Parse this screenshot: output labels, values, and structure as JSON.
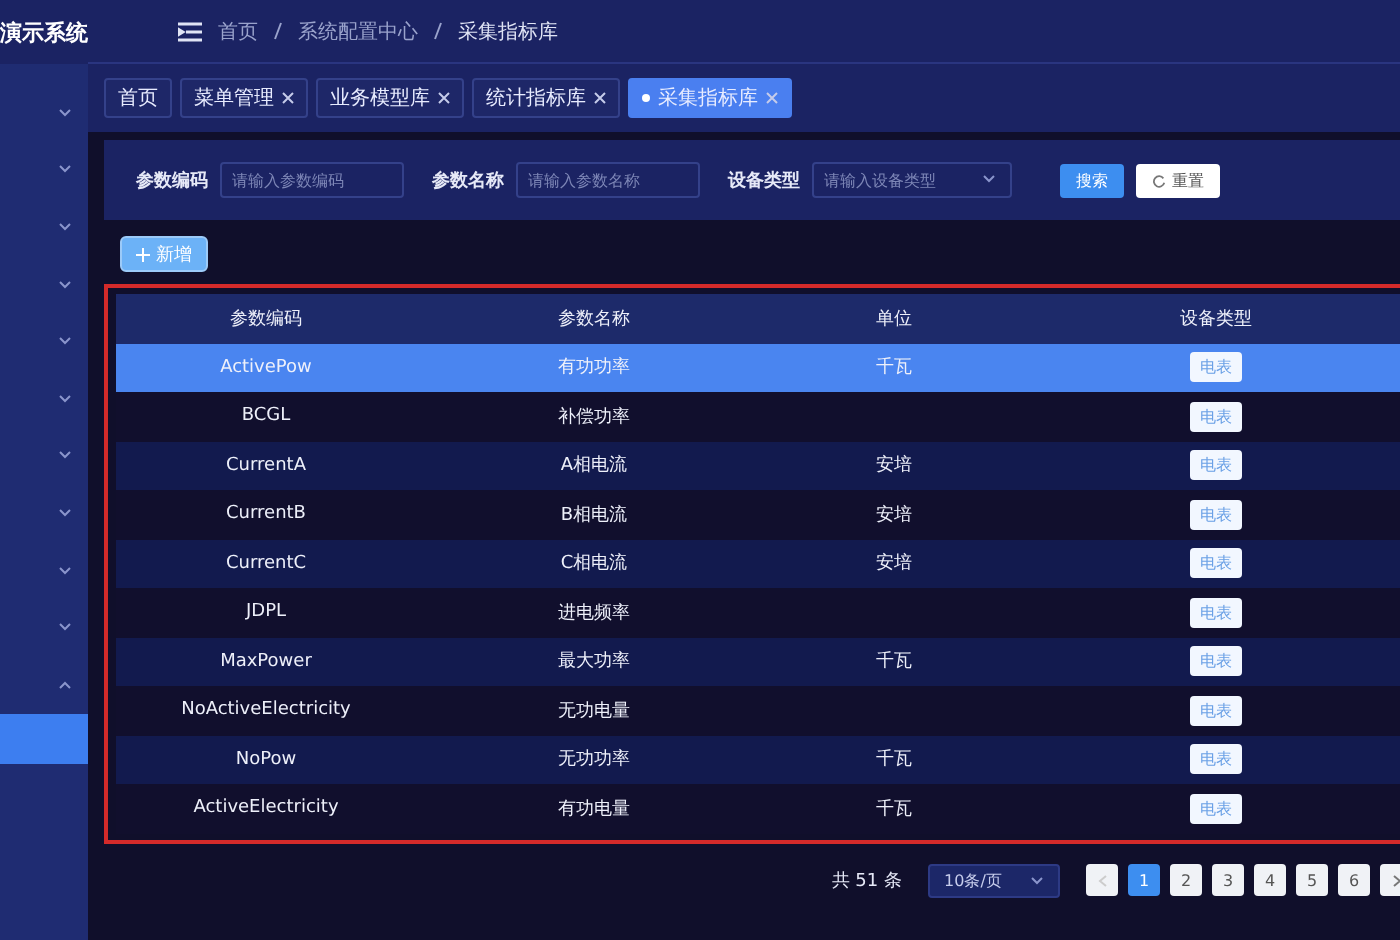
{
  "app_title": "演示系统",
  "sidebar": {
    "items": [
      {
        "expanded": false
      },
      {
        "expanded": false
      },
      {
        "expanded": false
      },
      {
        "expanded": false
      },
      {
        "expanded": false
      },
      {
        "expanded": false
      },
      {
        "expanded": false
      },
      {
        "expanded": false
      },
      {
        "expanded": false
      },
      {
        "expanded": false
      },
      {
        "expanded": true
      }
    ],
    "selected_child": true
  },
  "breadcrumb": [
    "首页",
    "系统配置中心",
    "采集指标库"
  ],
  "tabs": [
    {
      "label": "首页",
      "closable": false,
      "selected": false
    },
    {
      "label": "菜单管理",
      "closable": true,
      "selected": false
    },
    {
      "label": "业务模型库",
      "closable": true,
      "selected": false
    },
    {
      "label": "统计指标库",
      "closable": true,
      "selected": false
    },
    {
      "label": "采集指标库",
      "closable": true,
      "selected": true
    }
  ],
  "filters": [
    {
      "label": "参数编码",
      "placeholder": "请输入参数编码",
      "kind": "input"
    },
    {
      "label": "参数名称",
      "placeholder": "请输入参数名称",
      "kind": "input"
    },
    {
      "label": "设备类型",
      "placeholder": "请输入设备类型",
      "kind": "select"
    }
  ],
  "search_button": "搜索",
  "reset_button": "重置",
  "add_button": "新增",
  "table": {
    "columns": [
      "参数编码",
      "参数名称",
      "单位",
      "设备类型"
    ],
    "rows": [
      {
        "code": "ActivePow",
        "name": "有功功率",
        "unit": "千瓦",
        "type": "电表",
        "selected": true
      },
      {
        "code": "BCGL",
        "name": "补偿功率",
        "unit": "",
        "type": "电表",
        "selected": false
      },
      {
        "code": "CurrentA",
        "name": "A相电流",
        "unit": "安培",
        "type": "电表",
        "selected": false
      },
      {
        "code": "CurrentB",
        "name": "B相电流",
        "unit": "安培",
        "type": "电表",
        "selected": false
      },
      {
        "code": "CurrentC",
        "name": "C相电流",
        "unit": "安培",
        "type": "电表",
        "selected": false
      },
      {
        "code": "JDPL",
        "name": "进电频率",
        "unit": "",
        "type": "电表",
        "selected": false
      },
      {
        "code": "MaxPower",
        "name": "最大功率",
        "unit": "千瓦",
        "type": "电表",
        "selected": false
      },
      {
        "code": "NoActiveElectricity",
        "name": "无功电量",
        "unit": "",
        "type": "电表",
        "selected": false
      },
      {
        "code": "NoPow",
        "name": "无功功率",
        "unit": "千瓦",
        "type": "电表",
        "selected": false
      },
      {
        "code": "ActiveElectricity",
        "name": "有功电量",
        "unit": "千瓦",
        "type": "电表",
        "selected": false
      }
    ]
  },
  "pagination": {
    "total": "共 51 条",
    "page_size": "10条/页",
    "pages": [
      {
        "label": "1",
        "selected": true
      },
      {
        "label": "2",
        "selected": false
      },
      {
        "label": "3",
        "selected": false
      },
      {
        "label": "4",
        "selected": false
      },
      {
        "label": "5",
        "selected": false
      },
      {
        "label": "6",
        "selected": false
      }
    ]
  }
}
